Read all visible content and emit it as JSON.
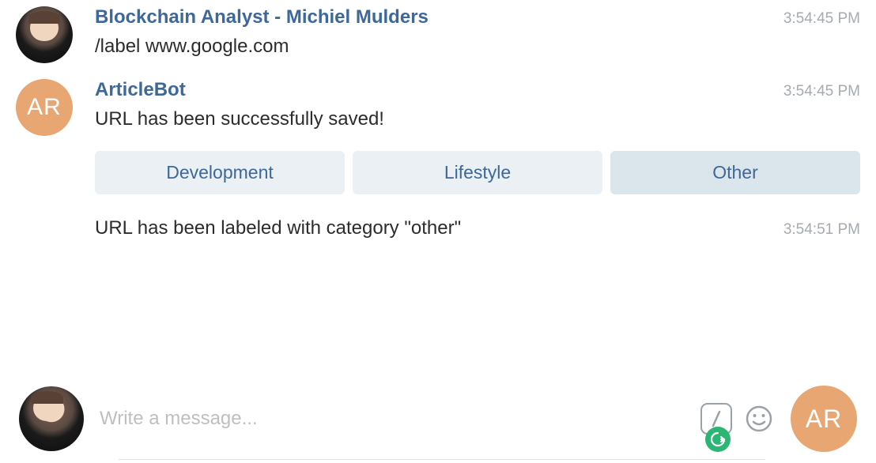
{
  "messages": [
    {
      "sender": "Blockchain Analyst - Michiel Mulders",
      "timestamp": "3:54:45 PM",
      "text": "/label www.google.com"
    },
    {
      "sender": "ArticleBot",
      "avatar_initials": "AR",
      "timestamp": "3:54:45 PM",
      "text": "URL has been successfully saved!",
      "buttons": [
        "Development",
        "Lifestyle",
        "Other"
      ],
      "selected_button": "Other",
      "followup_text": "URL has been labeled with category \"other\"",
      "followup_timestamp": "3:54:51 PM"
    }
  ],
  "composer": {
    "placeholder": "Write a message...",
    "bot_avatar_initials": "AR"
  },
  "icons": {
    "slash": "slash-command-icon",
    "emoji": "emoji-picker-icon",
    "grammarly": "grammarly-icon"
  }
}
